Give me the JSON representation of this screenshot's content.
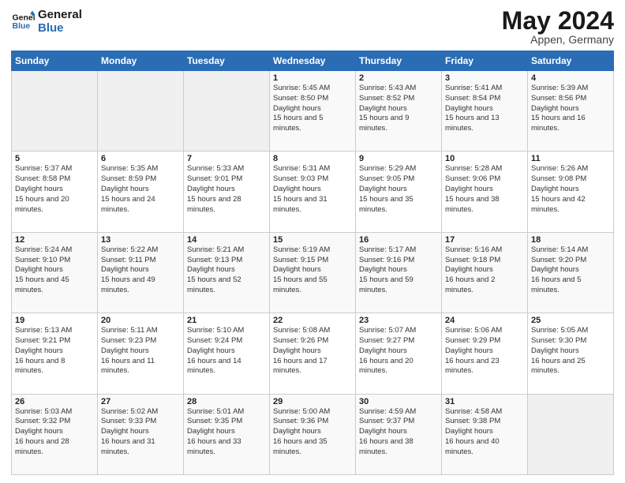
{
  "header": {
    "logo_line1": "General",
    "logo_line2": "Blue",
    "month": "May 2024",
    "location": "Appen, Germany"
  },
  "weekdays": [
    "Sunday",
    "Monday",
    "Tuesday",
    "Wednesday",
    "Thursday",
    "Friday",
    "Saturday"
  ],
  "weeks": [
    [
      {
        "day": "",
        "sunrise": "",
        "sunset": "",
        "daylight": ""
      },
      {
        "day": "",
        "sunrise": "",
        "sunset": "",
        "daylight": ""
      },
      {
        "day": "",
        "sunrise": "",
        "sunset": "",
        "daylight": ""
      },
      {
        "day": "1",
        "sunrise": "5:45 AM",
        "sunset": "8:50 PM",
        "daylight": "15 hours and 5 minutes."
      },
      {
        "day": "2",
        "sunrise": "5:43 AM",
        "sunset": "8:52 PM",
        "daylight": "15 hours and 9 minutes."
      },
      {
        "day": "3",
        "sunrise": "5:41 AM",
        "sunset": "8:54 PM",
        "daylight": "15 hours and 13 minutes."
      },
      {
        "day": "4",
        "sunrise": "5:39 AM",
        "sunset": "8:56 PM",
        "daylight": "15 hours and 16 minutes."
      }
    ],
    [
      {
        "day": "5",
        "sunrise": "5:37 AM",
        "sunset": "8:58 PM",
        "daylight": "15 hours and 20 minutes."
      },
      {
        "day": "6",
        "sunrise": "5:35 AM",
        "sunset": "8:59 PM",
        "daylight": "15 hours and 24 minutes."
      },
      {
        "day": "7",
        "sunrise": "5:33 AM",
        "sunset": "9:01 PM",
        "daylight": "15 hours and 28 minutes."
      },
      {
        "day": "8",
        "sunrise": "5:31 AM",
        "sunset": "9:03 PM",
        "daylight": "15 hours and 31 minutes."
      },
      {
        "day": "9",
        "sunrise": "5:29 AM",
        "sunset": "9:05 PM",
        "daylight": "15 hours and 35 minutes."
      },
      {
        "day": "10",
        "sunrise": "5:28 AM",
        "sunset": "9:06 PM",
        "daylight": "15 hours and 38 minutes."
      },
      {
        "day": "11",
        "sunrise": "5:26 AM",
        "sunset": "9:08 PM",
        "daylight": "15 hours and 42 minutes."
      }
    ],
    [
      {
        "day": "12",
        "sunrise": "5:24 AM",
        "sunset": "9:10 PM",
        "daylight": "15 hours and 45 minutes."
      },
      {
        "day": "13",
        "sunrise": "5:22 AM",
        "sunset": "9:11 PM",
        "daylight": "15 hours and 49 minutes."
      },
      {
        "day": "14",
        "sunrise": "5:21 AM",
        "sunset": "9:13 PM",
        "daylight": "15 hours and 52 minutes."
      },
      {
        "day": "15",
        "sunrise": "5:19 AM",
        "sunset": "9:15 PM",
        "daylight": "15 hours and 55 minutes."
      },
      {
        "day": "16",
        "sunrise": "5:17 AM",
        "sunset": "9:16 PM",
        "daylight": "15 hours and 59 minutes."
      },
      {
        "day": "17",
        "sunrise": "5:16 AM",
        "sunset": "9:18 PM",
        "daylight": "16 hours and 2 minutes."
      },
      {
        "day": "18",
        "sunrise": "5:14 AM",
        "sunset": "9:20 PM",
        "daylight": "16 hours and 5 minutes."
      }
    ],
    [
      {
        "day": "19",
        "sunrise": "5:13 AM",
        "sunset": "9:21 PM",
        "daylight": "16 hours and 8 minutes."
      },
      {
        "day": "20",
        "sunrise": "5:11 AM",
        "sunset": "9:23 PM",
        "daylight": "16 hours and 11 minutes."
      },
      {
        "day": "21",
        "sunrise": "5:10 AM",
        "sunset": "9:24 PM",
        "daylight": "16 hours and 14 minutes."
      },
      {
        "day": "22",
        "sunrise": "5:08 AM",
        "sunset": "9:26 PM",
        "daylight": "16 hours and 17 minutes."
      },
      {
        "day": "23",
        "sunrise": "5:07 AM",
        "sunset": "9:27 PM",
        "daylight": "16 hours and 20 minutes."
      },
      {
        "day": "24",
        "sunrise": "5:06 AM",
        "sunset": "9:29 PM",
        "daylight": "16 hours and 23 minutes."
      },
      {
        "day": "25",
        "sunrise": "5:05 AM",
        "sunset": "9:30 PM",
        "daylight": "16 hours and 25 minutes."
      }
    ],
    [
      {
        "day": "26",
        "sunrise": "5:03 AM",
        "sunset": "9:32 PM",
        "daylight": "16 hours and 28 minutes."
      },
      {
        "day": "27",
        "sunrise": "5:02 AM",
        "sunset": "9:33 PM",
        "daylight": "16 hours and 31 minutes."
      },
      {
        "day": "28",
        "sunrise": "5:01 AM",
        "sunset": "9:35 PM",
        "daylight": "16 hours and 33 minutes."
      },
      {
        "day": "29",
        "sunrise": "5:00 AM",
        "sunset": "9:36 PM",
        "daylight": "16 hours and 35 minutes."
      },
      {
        "day": "30",
        "sunrise": "4:59 AM",
        "sunset": "9:37 PM",
        "daylight": "16 hours and 38 minutes."
      },
      {
        "day": "31",
        "sunrise": "4:58 AM",
        "sunset": "9:38 PM",
        "daylight": "16 hours and 40 minutes."
      },
      {
        "day": "",
        "sunrise": "",
        "sunset": "",
        "daylight": ""
      }
    ]
  ]
}
